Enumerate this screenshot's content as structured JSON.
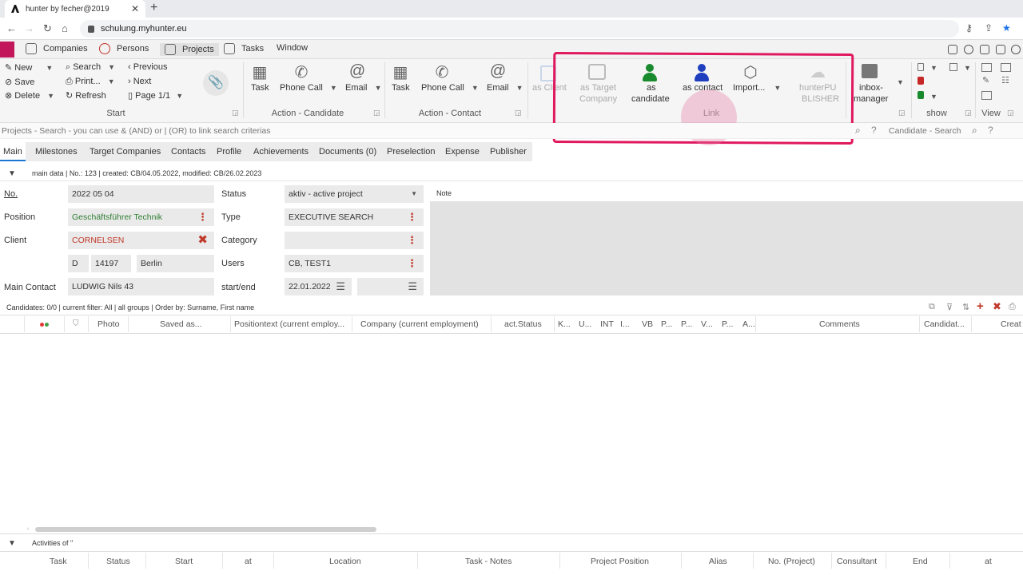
{
  "browser": {
    "tab_title": "hunter by fecher@2019",
    "url": "schulung.myhunter.eu"
  },
  "menu": {
    "items": [
      "Companies",
      "Persons",
      "Projects",
      "Tasks",
      "Window"
    ]
  },
  "ribbon": {
    "start": {
      "new": "New",
      "save": "Save",
      "delete": "Delete",
      "search": "Search",
      "print": "Print...",
      "refresh": "Refresh",
      "previous": "Previous",
      "next": "Next",
      "page": "Page 1/1",
      "group": "Start"
    },
    "action_candidate": {
      "task": "Task",
      "phone": "Phone Call",
      "email": "Email",
      "group": "Action - Candidate"
    },
    "action_contact": {
      "task": "Task",
      "phone": "Phone Call",
      "email": "Email",
      "group": "Action - Contact"
    },
    "link": {
      "as_client": "as Client",
      "as_target": "as Target",
      "as_target2": "Company",
      "as_candidate": "as",
      "as_candidate2": "candidate",
      "as_contact": "as contact",
      "import": "Import...",
      "group": "Link"
    },
    "publisher": {
      "l1": "hunterPU",
      "l2": "BLISHER"
    },
    "inbox": {
      "l1": "inbox-",
      "l2": "manager"
    },
    "show": "show",
    "view": "View"
  },
  "search": {
    "projects_placeholder": "Projects - Search - you can use & (AND) or | (OR) to link search criterias",
    "candidate_placeholder": "Candidate - Search"
  },
  "tabs": [
    "Main",
    "Milestones",
    "Target Companies",
    "Contacts",
    "Profile",
    "Achievements",
    "Documents (0)",
    "Preselection",
    "Expense",
    "Publisher"
  ],
  "maindata": {
    "header": "main data | No.: 123 | created: CB/04.05.2022, modified: CB/26.02.2023"
  },
  "form": {
    "no_label": "No.",
    "no": "2022 05 04",
    "position_label": "Position",
    "position": "Geschäftsführer Technik",
    "client_label": "Client",
    "client": "CORNELSEN",
    "country": "D",
    "zip": "14197",
    "city": "Berlin",
    "main_contact_label": "Main Contact",
    "main_contact": "LUDWIG Nils 43",
    "status_label": "Status",
    "status": "aktiv - active project",
    "type_label": "Type",
    "type": "EXECUTIVE SEARCH",
    "category_label": "Category",
    "category": "",
    "users_label": "Users",
    "users": "CB, TEST1",
    "startend_label": "start/end",
    "start": "22.01.2022",
    "note_label": "Note"
  },
  "candidates": {
    "summary": "Candidates: 0/0 | current filter: All | all groups | Order by: Surname, First name",
    "columns": [
      "Photo",
      "Saved as...",
      "Positiontext (current employ...",
      "Company (current employment)",
      "act.Status",
      "K...",
      "U...",
      "INT",
      "I...",
      "VB",
      "P...",
      "P...",
      "V...",
      "P...",
      "A...",
      "Comments",
      "Candidat...",
      "Creat"
    ]
  },
  "activities": {
    "title": "Activities of \"",
    "columns": [
      "Task",
      "Status",
      "Start",
      "at",
      "Location",
      "Task - Notes",
      "Project Position",
      "Alias",
      "No. (Project)",
      "Consultant",
      "End",
      "at"
    ]
  },
  "colors": {
    "highlight": "#e0185e",
    "accent": "#1976d2",
    "client_red": "#c0392b"
  }
}
